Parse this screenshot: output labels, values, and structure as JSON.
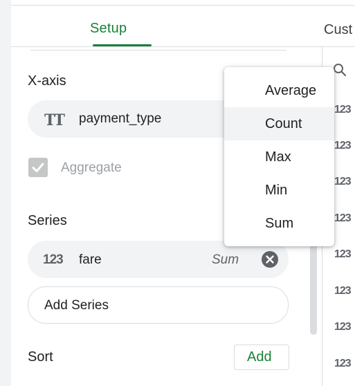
{
  "tabs": {
    "setup": "Setup",
    "customize": "Cust"
  },
  "x_axis": {
    "title": "X-axis",
    "field_icon": "text-type-icon",
    "field_icon_glyph": "TT",
    "field": "payment_type",
    "aggregate_label": "Aggregate",
    "aggregate_checked": true
  },
  "series": {
    "title": "Series",
    "items": [
      {
        "icon": "123",
        "name": "fare",
        "aggregation": "Sum"
      }
    ],
    "add_label": "Add Series"
  },
  "sort": {
    "title": "Sort",
    "add_label": "Add"
  },
  "aggregation_menu": {
    "options": [
      "Average",
      "Count",
      "Max",
      "Min",
      "Sum"
    ],
    "highlighted": "Count"
  },
  "columns_panel": {
    "type_glyph": "123"
  },
  "colors": {
    "accent": "#188038",
    "chip": "#f1f3f4",
    "text": "#202124",
    "muted": "#5f6368"
  }
}
